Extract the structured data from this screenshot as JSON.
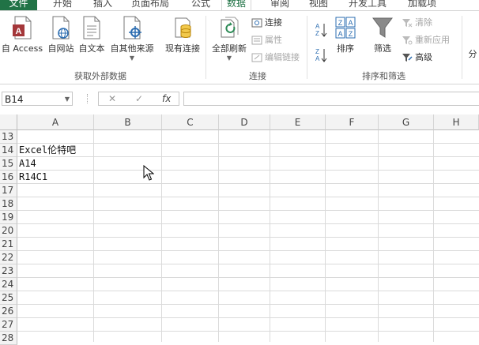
{
  "tabs": [
    "文件",
    "开始",
    "插入",
    "页面布局",
    "公式",
    "数据",
    "审阅",
    "视图",
    "开发工具",
    "加载项"
  ],
  "ribbon": {
    "external": {
      "access": "自 Access",
      "web": "自网站",
      "text": "自文本",
      "other": "自其他来源",
      "existing": "现有连接",
      "group": "获取外部数据"
    },
    "connections": {
      "refresh": "全部刷新",
      "connections": "连接",
      "properties": "属性",
      "edit_links": "编辑链接",
      "group": "连接"
    },
    "sort_filter": {
      "sort": "排序",
      "filter": "筛选",
      "clear": "清除",
      "reapply": "重新应用",
      "advanced": "高级",
      "group": "排序和筛选"
    },
    "split_partial": "分"
  },
  "formula_bar": {
    "name_box": "B14",
    "cancel": "✕",
    "enter": "✓",
    "fx": "fx",
    "content": ""
  },
  "columns": [
    "A",
    "B",
    "C",
    "D",
    "E",
    "F",
    "G",
    "H"
  ],
  "rows": [
    "13",
    "14",
    "15",
    "16",
    "17",
    "18",
    "19",
    "20",
    "21",
    "22",
    "23",
    "24",
    "25",
    "26",
    "27",
    "28"
  ],
  "cells": {
    "a14": "Excel伦特吧",
    "a15": "A14",
    "a16": "R14C1"
  },
  "colors": {
    "excel_green": "#217346",
    "grid": "#dadada",
    "header_bg": "#f3f3f3"
  }
}
